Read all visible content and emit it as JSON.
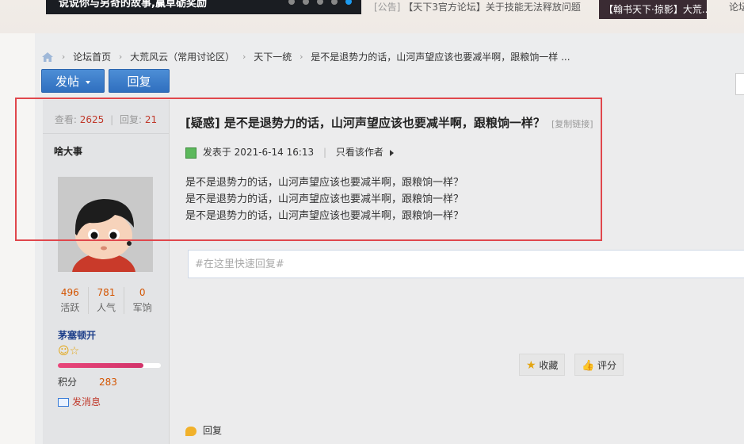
{
  "top": {
    "banner_text": "说说你与另奇的故事,赢草砺奖励",
    "notice_tag": "[公告]",
    "notice_text": "【天下3官方论坛】关于技能无法释放问题",
    "notice_image_text": "【翰书天下·掠影】大荒...",
    "right_text": "论坛"
  },
  "breadcrumb": [
    "论坛首页",
    "大荒风云（常用讨论区）",
    "天下一统",
    "是不是退势力的话，山河声望应该也要减半啊，跟粮饷一样 ..."
  ],
  "toolbar": {
    "post_label": "发帖",
    "reply_label": "回复"
  },
  "thread": {
    "views_label": "查看:",
    "views": "2625",
    "replies_label": "回复:",
    "replies": "21",
    "title": "[疑惑] 是不是退势力的话，山河声望应该也要减半啊，跟粮饷一样？",
    "copy_link": "[复制链接]"
  },
  "author": {
    "name": "啥大事",
    "stats": [
      {
        "value": "496",
        "label": "活跃"
      },
      {
        "value": "781",
        "label": "人气"
      },
      {
        "value": "0",
        "label": "军饷"
      }
    ],
    "rank": "茅塞顿开",
    "progress": 0.83,
    "points_label": "积分",
    "points": "283",
    "pm_label": "发消息"
  },
  "post": {
    "meta_prefix": "发表于",
    "date": "2021-6-14 16:13",
    "only_author": "只看该作者",
    "lines": [
      "是不是退势力的话，山河声望应该也要减半啊，跟粮饷一样？",
      "是不是退势力的话，山河声望应该也要减半啊，跟粮饷一样？",
      "是不是退势力的话，山河声望应该也要减半啊，跟粮饷一样？"
    ]
  },
  "quick_reply": {
    "placeholder": "#在这里快速回复#"
  },
  "actions": {
    "favorite": "收藏",
    "rate": "评分",
    "reply": "回复"
  },
  "colors": {
    "highlight": "#e0474c",
    "primary": "#2f6fbf",
    "number": "#d35400"
  }
}
